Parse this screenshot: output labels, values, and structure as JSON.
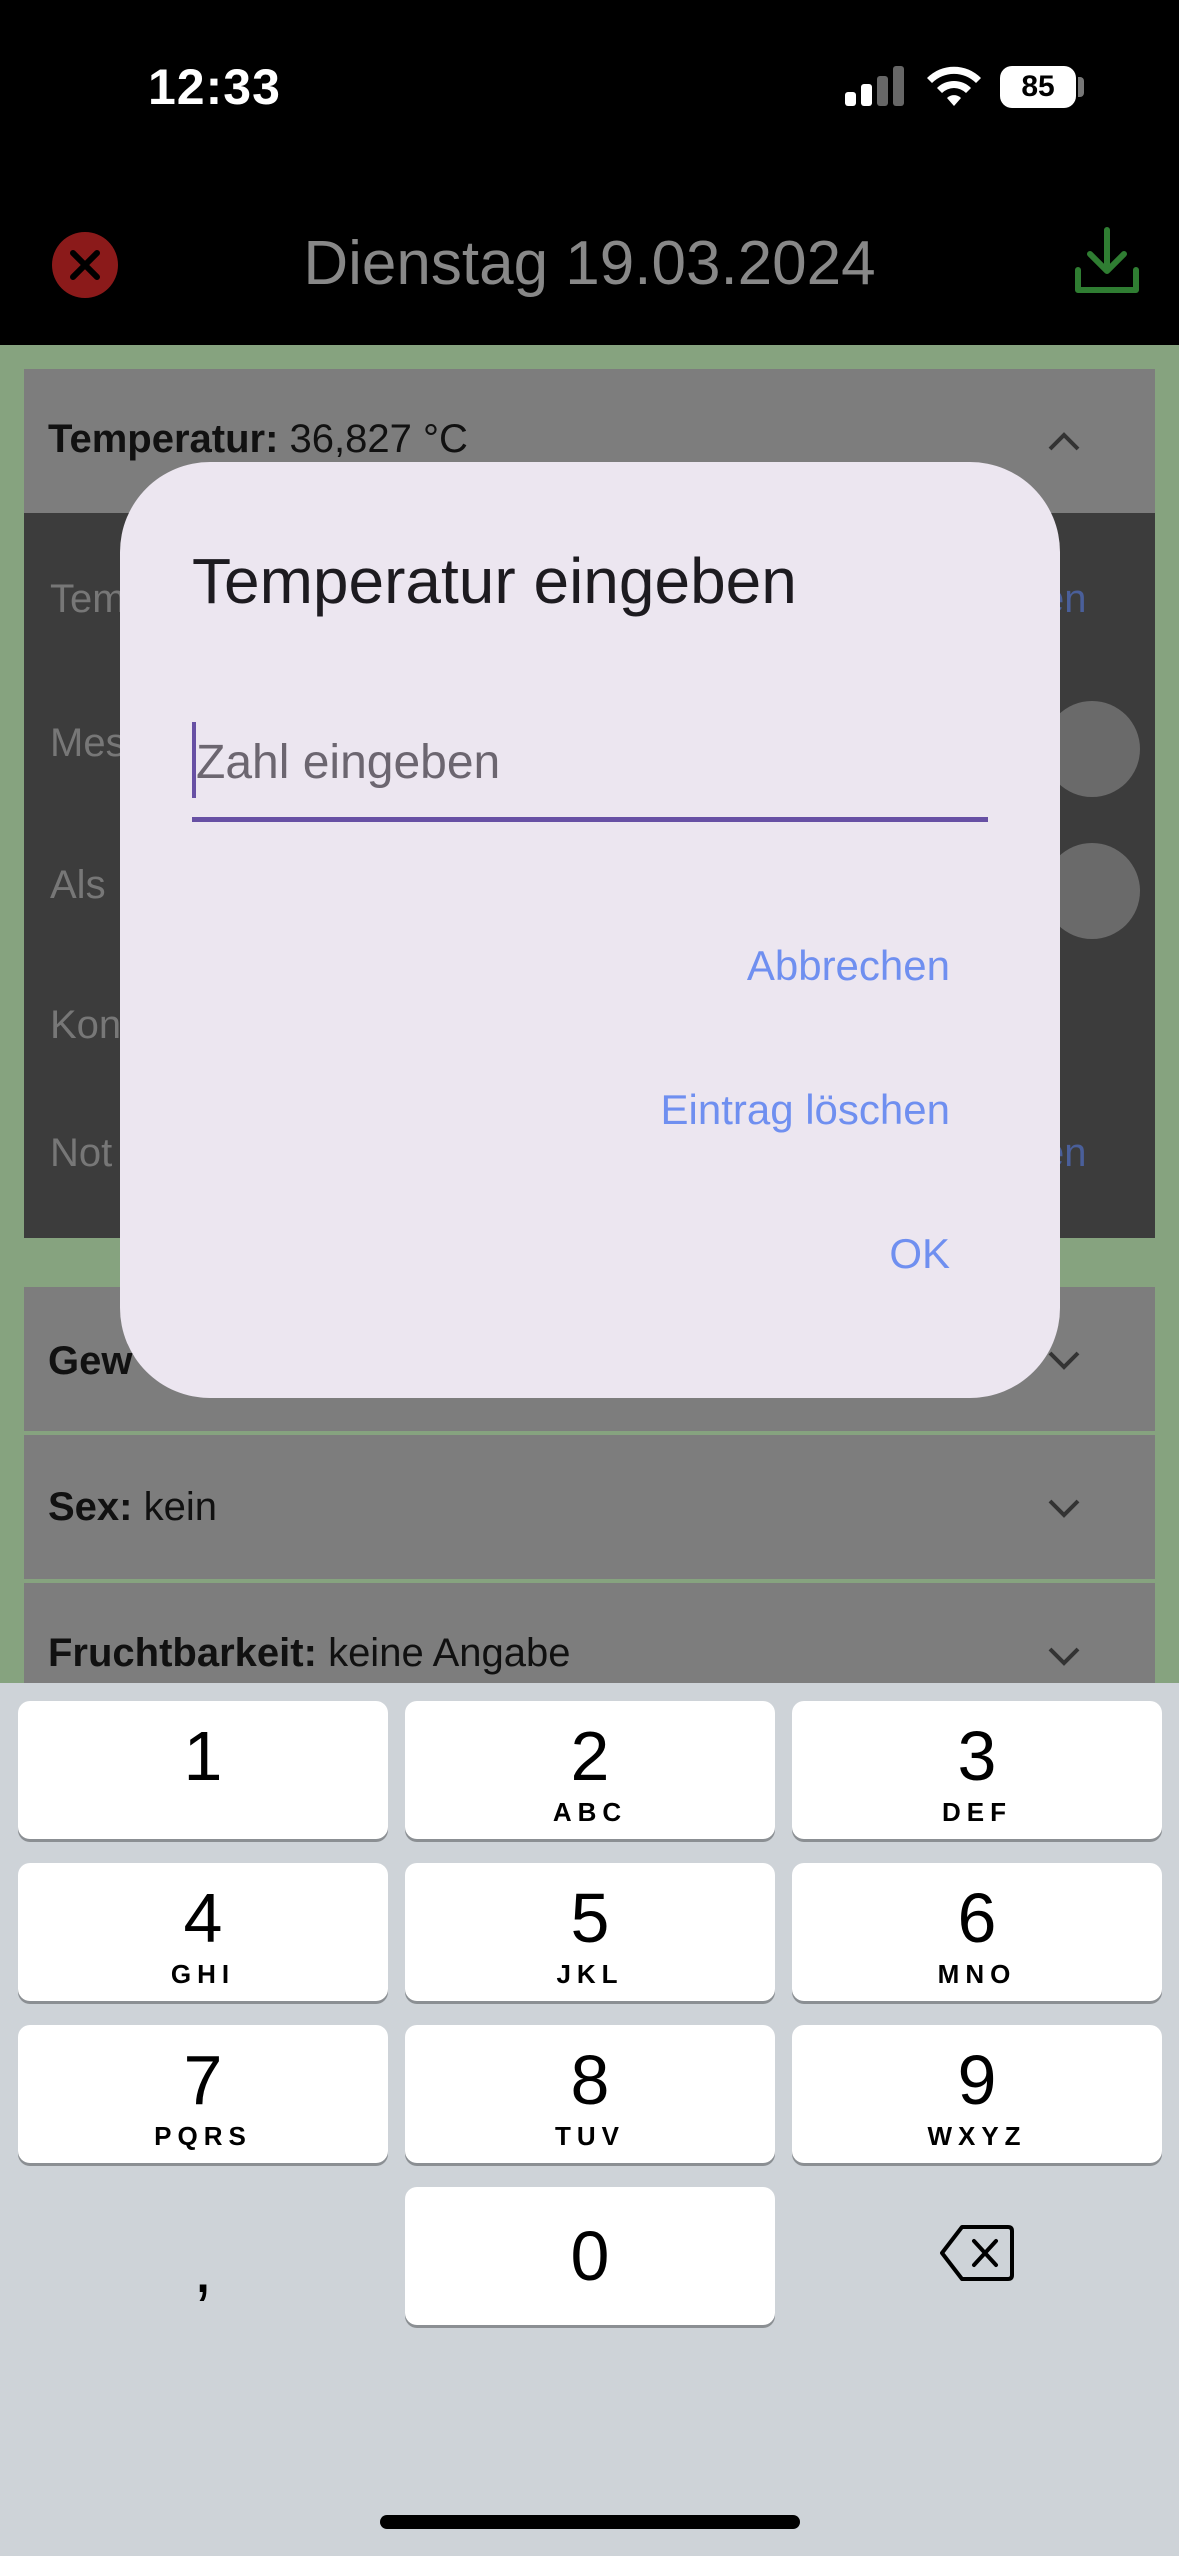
{
  "status_bar": {
    "time": "12:33",
    "battery": "85"
  },
  "header": {
    "title": "Dienstag 19.03.2024"
  },
  "background": {
    "temperature": {
      "label": "Temperatur:",
      "value": "36,827 °C"
    },
    "details": [
      {
        "label": "Tem",
        "link": "en"
      },
      {
        "label": "Mes"
      },
      {
        "label": "Als"
      },
      {
        "label": "Kon"
      },
      {
        "label": "Not",
        "link": "en"
      }
    ],
    "weight": {
      "label": "Gew"
    },
    "sex": {
      "label": "Sex:",
      "value": "kein"
    },
    "fertility": {
      "label": "Fruchtbarkeit:",
      "value": "keine Angabe"
    }
  },
  "dialog": {
    "title": "Temperatur eingeben",
    "input_placeholder": "Zahl eingeben",
    "input_value": "",
    "cancel_label": "Abbrechen",
    "delete_label": "Eintrag löschen",
    "ok_label": "OK",
    "accent_color": "#6750a4",
    "button_color": "#6f8ff0"
  },
  "keyboard": {
    "keys": [
      {
        "num": "1",
        "letters": ""
      },
      {
        "num": "2",
        "letters": "ABC"
      },
      {
        "num": "3",
        "letters": "DEF"
      },
      {
        "num": "4",
        "letters": "GHI"
      },
      {
        "num": "5",
        "letters": "JKL"
      },
      {
        "num": "6",
        "letters": "MNO"
      },
      {
        "num": "7",
        "letters": "PQRS"
      },
      {
        "num": "8",
        "letters": "TUV"
      },
      {
        "num": "9",
        "letters": "WXYZ"
      },
      {
        "num": "0",
        "letters": ""
      }
    ],
    "comma": ",",
    "delete_icon": "backspace-icon"
  }
}
